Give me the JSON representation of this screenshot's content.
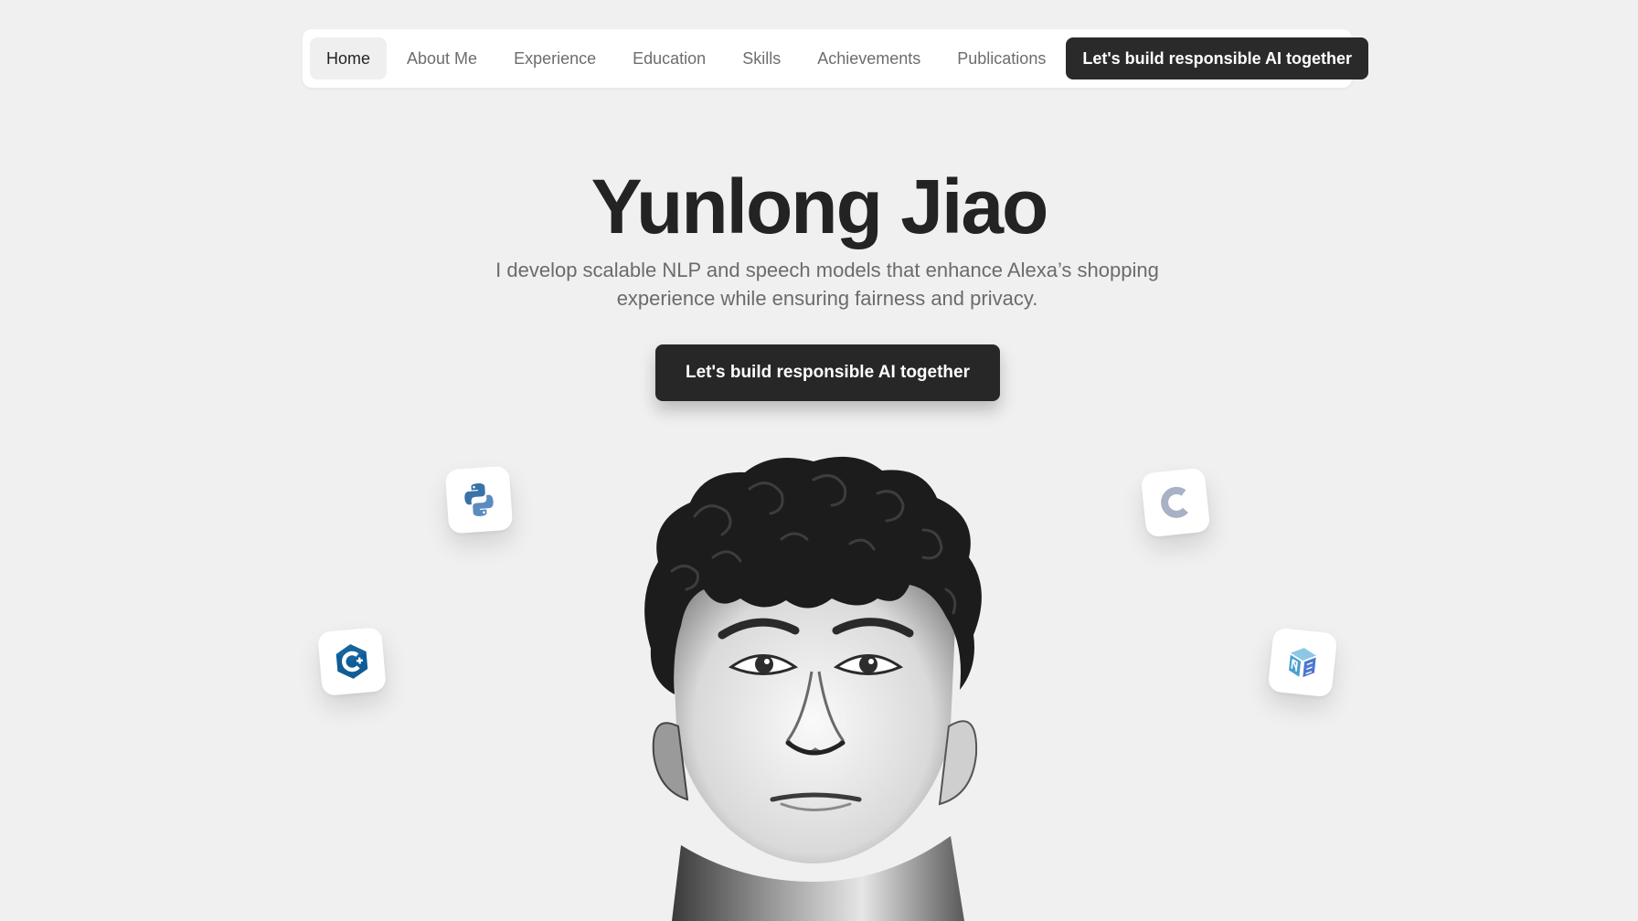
{
  "nav": {
    "items": [
      {
        "label": "Home",
        "active": true
      },
      {
        "label": "About Me",
        "active": false
      },
      {
        "label": "Experience",
        "active": false
      },
      {
        "label": "Education",
        "active": false
      },
      {
        "label": "Skills",
        "active": false
      },
      {
        "label": "Achievements",
        "active": false
      },
      {
        "label": "Publications",
        "active": false
      }
    ],
    "cta_label": "Let's build responsible AI together"
  },
  "hero": {
    "title": "Yunlong Jiao",
    "subtitle": "I develop scalable NLP and speech models that enhance Alexa’s shopping experience while ensuring fairness and privacy.",
    "cta_label": "Let's build responsible AI together"
  },
  "floating_icons": [
    {
      "name": "python-icon",
      "colors": [
        "#3776ab",
        "#4b7fb6"
      ]
    },
    {
      "name": "c-language-icon",
      "colors": [
        "#a8b3c8"
      ]
    },
    {
      "name": "cpp-icon",
      "colors": [
        "#00599c",
        "#004482"
      ]
    },
    {
      "name": "numpy-icon",
      "colors": [
        "#4dabcf",
        "#4d77cf"
      ]
    }
  ],
  "portrait": {
    "icon": "portrait-illustration"
  },
  "colors": {
    "background": "#f0f0f0",
    "nav_background": "#ffffff",
    "button_dark": "#2a2a2b",
    "text_primary": "#232323",
    "text_muted": "#6b6b6b"
  }
}
